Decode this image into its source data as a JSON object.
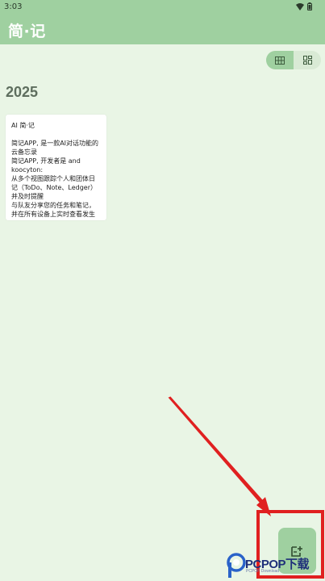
{
  "status_bar": {
    "time": "3:03"
  },
  "app_bar": {
    "title": "简·记"
  },
  "view_toggle": {
    "options": [
      "grid-view-icon",
      "dashboard-view-icon"
    ],
    "active_index": 0
  },
  "section": {
    "year": "2025"
  },
  "notes": [
    {
      "title": "AI 简·记",
      "body": "简记APP, 是一款AI对话功能的云备忘录\n简记APP, 开发者是 and koocyton:\n从多个视图跟踪个人和团体日记（ToDo、Note、Ledger）并及时提醒\n与队友分享您的任务和笔记，并在所有设备上实时查看发生"
    }
  ],
  "fab": {
    "icon": "add-note-icon"
  },
  "watermark": {
    "brand": "PCPOP下载",
    "sub": "PCPOP Download"
  },
  "colors": {
    "accent": "#9fd0a0",
    "background": "#e9f5e5",
    "annotation": "#e02020",
    "watermark": "#1f2f7a"
  }
}
